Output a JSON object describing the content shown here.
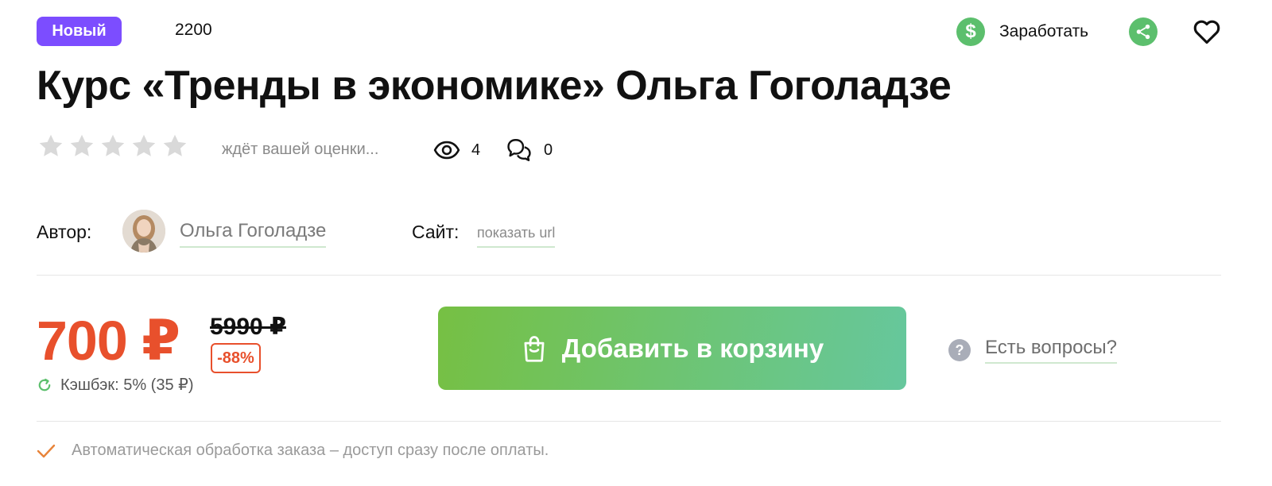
{
  "badge": {
    "label": "Новый",
    "color": "#7c4dff"
  },
  "product_id": "2200",
  "actions": {
    "earn_label": "Заработать",
    "earn_icon": "dollar-coin-icon",
    "share_icon": "share-icon",
    "favorite_icon": "heart-icon"
  },
  "title": "Курс «Тренды в экономике» Ольга Гоголадзе",
  "rating": {
    "stars_filled": 0,
    "stars_total": 5,
    "status_text": "ждёт вашей оценки..."
  },
  "stats": {
    "views": "4",
    "comments": "0"
  },
  "author": {
    "label": "Автор:",
    "name": "Ольга Гоголадзе"
  },
  "site": {
    "label": "Сайт:",
    "link_text": "показать url"
  },
  "pricing": {
    "price": "700 ₽",
    "old_price": "5990 ₽",
    "discount": "-88%",
    "cashback": "Кэшбэк: 5% (35 ₽)",
    "price_color": "#e8502c"
  },
  "cart_button": {
    "label": "Добавить в корзину"
  },
  "faq": {
    "label": "Есть вопросы?"
  },
  "note": "Автоматическая обработка заказа – доступ сразу после оплаты."
}
